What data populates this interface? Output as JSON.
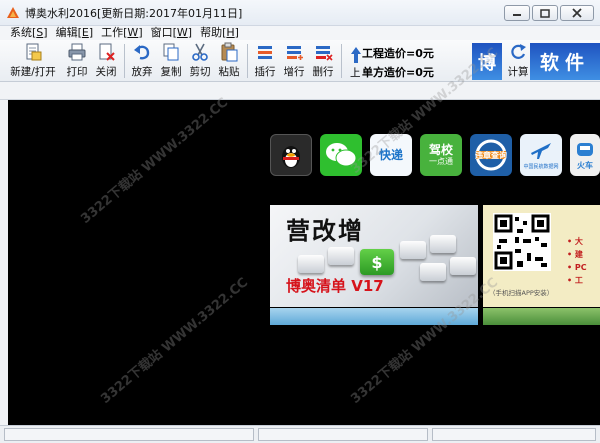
{
  "window": {
    "title": "博奥水利2016[更新日期:2017年01月11日]",
    "controls": [
      "minimize",
      "maximize",
      "close"
    ]
  },
  "menu": [
    {
      "label": "系统",
      "key": "S"
    },
    {
      "label": "编辑",
      "key": "E"
    },
    {
      "label": "工作",
      "key": "W"
    },
    {
      "label": "窗口",
      "key": "W"
    },
    {
      "label": "帮助",
      "key": "H"
    }
  ],
  "toolbar": {
    "new_open": "新建/打开",
    "print": "打印",
    "close": "关闭",
    "discard": "放弃",
    "copy": "复制",
    "cut": "剪切",
    "paste": "粘贴",
    "insert_row": "插行",
    "add_row": "增行",
    "delete_row": "删行",
    "calc": "计算"
  },
  "cost": {
    "project_cost": "工程造价=0元",
    "unit_cost": "单方造价=0元",
    "up_label": "上"
  },
  "banner": {
    "char1": "博",
    "chars": "软件"
  },
  "apps": [
    {
      "name": "qq-icon",
      "text": ""
    },
    {
      "name": "wechat-icon",
      "text": ""
    },
    {
      "name": "express-icon",
      "text": "快递",
      "sub": ""
    },
    {
      "name": "driving-school-icon",
      "text": "驾校",
      "sub": "一点通"
    },
    {
      "name": "violation-query-icon",
      "text": "违章查询",
      "sub": ""
    },
    {
      "name": "civil-aviation-icon",
      "text": "",
      "sub": "中国民航数据网"
    },
    {
      "name": "train-icon",
      "text": "火车",
      "sub": ""
    }
  ],
  "ad": {
    "title": "营改增",
    "product": "博奥清单 V17",
    "key_symbol": "$",
    "qr_caption": "（手机扫描APP安装）",
    "qr_list": [
      "• 大",
      "• 建",
      "• PC",
      "• 工"
    ]
  },
  "watermark": "3322下载站 WWW.3322.CC",
  "colors": {
    "accent_red": "#d6131b",
    "banner_blue": "#2e6fd4",
    "main_bg": "#000000"
  }
}
